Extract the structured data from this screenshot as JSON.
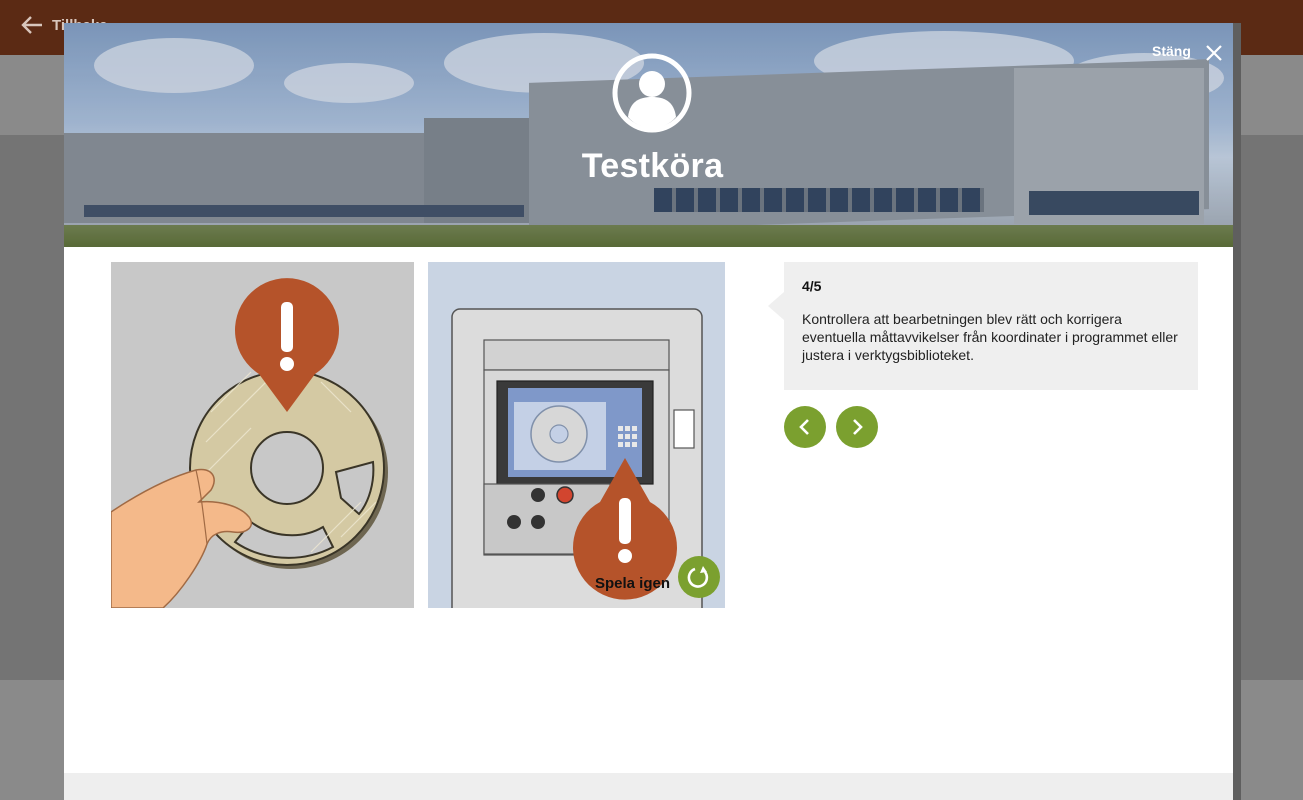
{
  "background": {
    "back_label": "Tillbaka"
  },
  "modal": {
    "title": "Testköra",
    "close_label": "Stäng",
    "step": "4/5",
    "step_text": "Kontrollera att bearbetningen blev rätt och korrigera eventuella måttavvikelser från koordinater i programmet eller justera i verktygsbiblioteket.",
    "replay_label": "Spela igen",
    "icons": {
      "close": "close-icon",
      "prev": "chevron-left-icon",
      "next": "chevron-right-icon",
      "replay": "replay-icon",
      "avatar": "user-avatar-icon",
      "back": "arrow-left-icon",
      "warning": "exclamation-marker-icon"
    }
  },
  "colors": {
    "topbar": "#5b2a14",
    "accent_green": "#7ba02f",
    "warning_orange": "#b5532a",
    "bubble_bg": "#efefef"
  }
}
